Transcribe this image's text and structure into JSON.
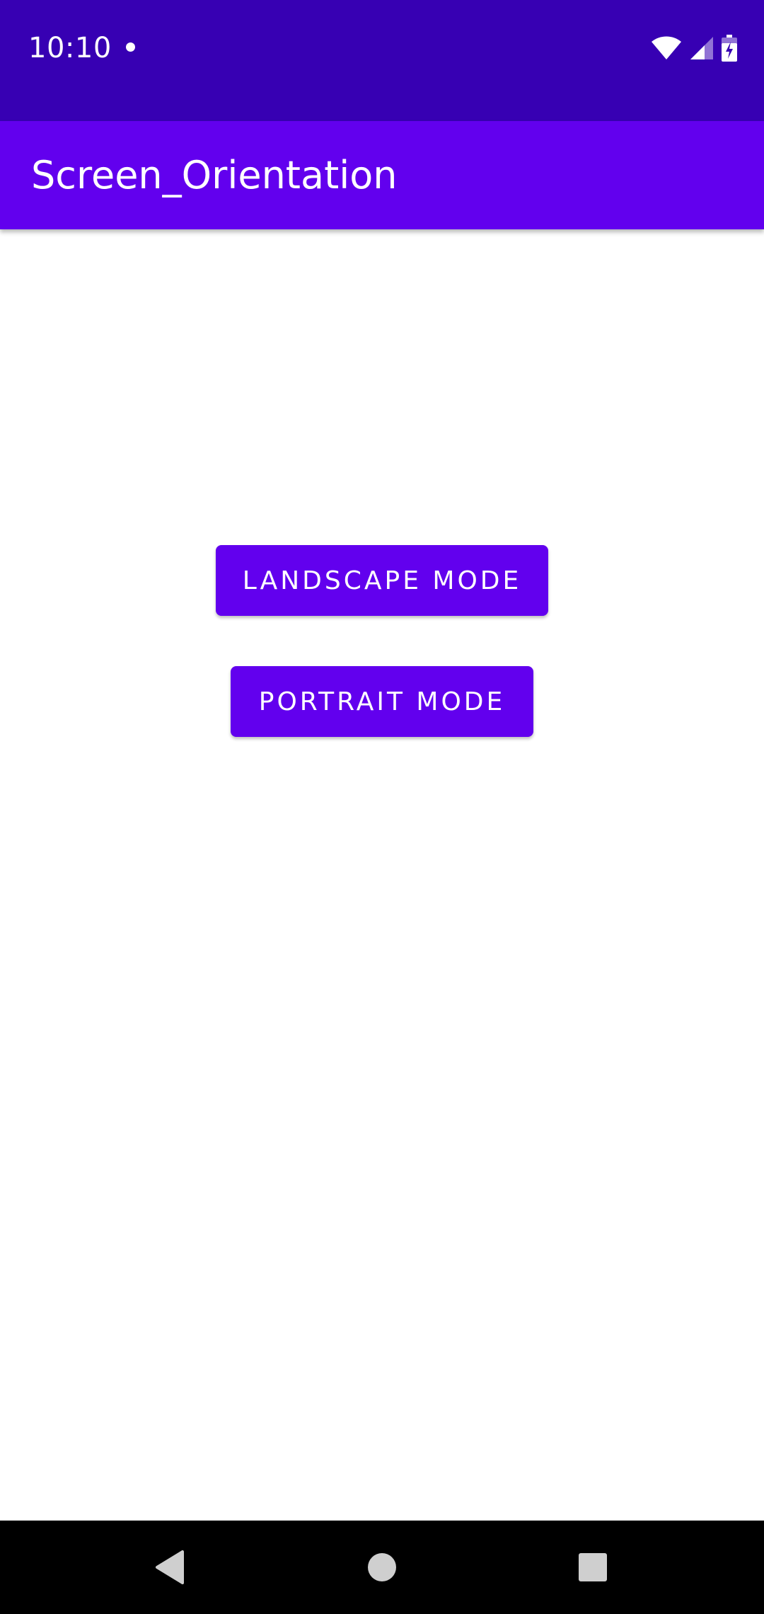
{
  "status_bar": {
    "time": "10:10",
    "icons": [
      "notification-dot-icon",
      "wifi-icon",
      "cell-signal-icon",
      "battery-icon"
    ]
  },
  "app_bar": {
    "title": "Screen_Orientation"
  },
  "main": {
    "buttons": [
      {
        "label": "LANDSCAPE MODE"
      },
      {
        "label": "PORTRAIT MODE"
      }
    ]
  },
  "nav_bar": {
    "icons": [
      "back-icon",
      "home-icon",
      "recents-icon"
    ]
  },
  "colors": {
    "status_bar": "#3700B3",
    "primary": "#6200EE",
    "background": "#FFFFFF",
    "nav_bar": "#000000"
  }
}
